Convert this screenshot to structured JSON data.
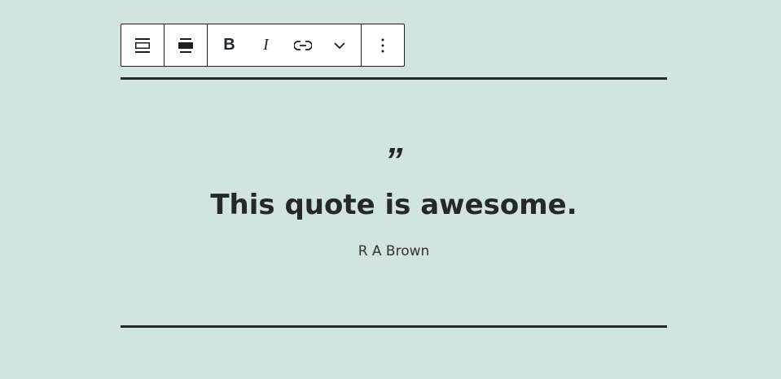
{
  "toolbar": {
    "buttons": [
      "block-type",
      "align",
      "bold",
      "italic",
      "link",
      "more-rich-text",
      "options"
    ]
  },
  "quote": {
    "mark": "”",
    "text": "This quote is awesome.",
    "citation": "R A Brown"
  }
}
